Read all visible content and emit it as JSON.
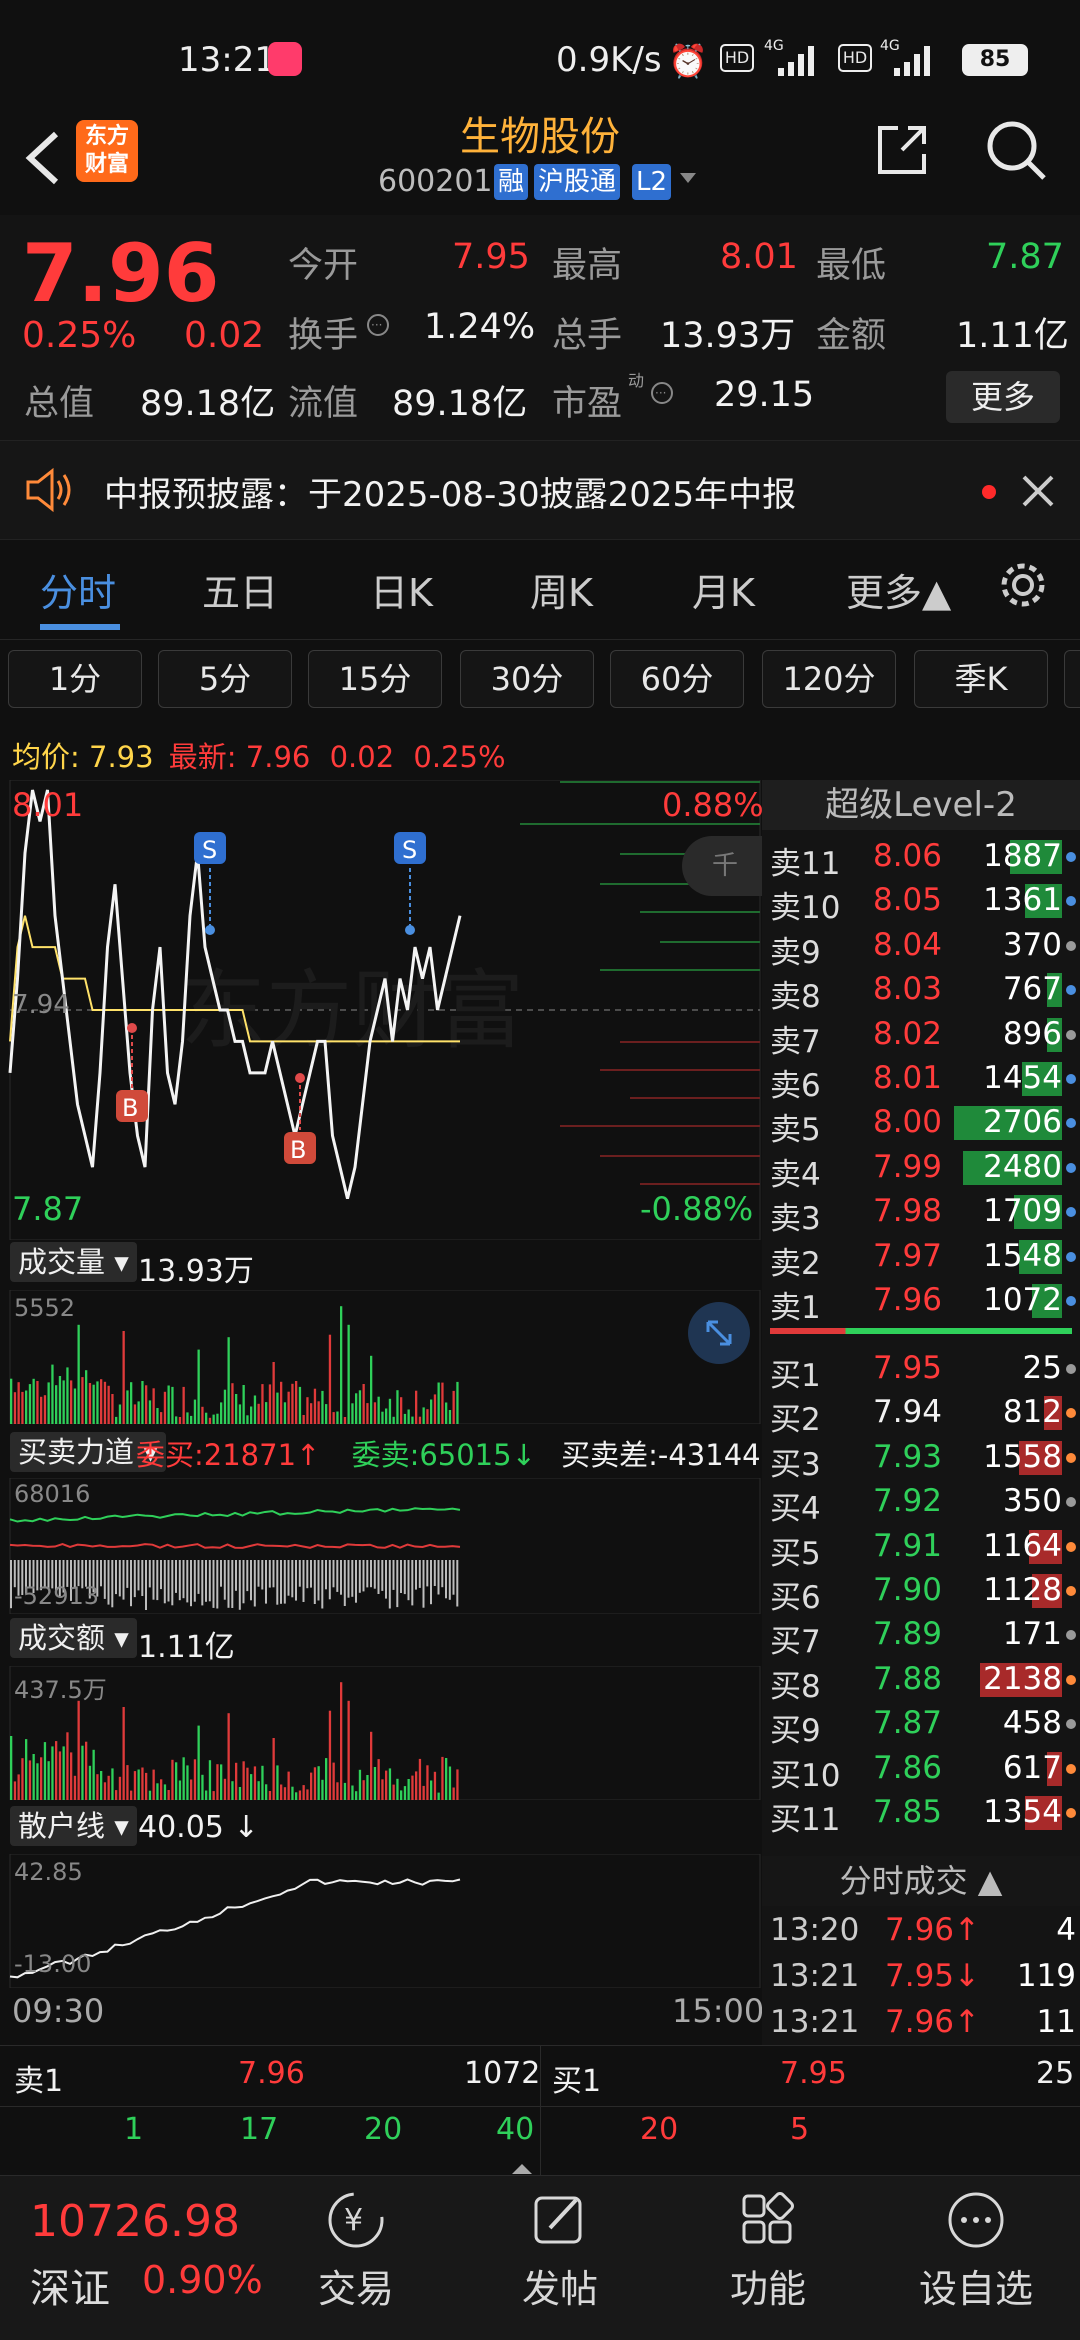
{
  "status": {
    "time": "13:21",
    "network_speed": "0.9K/s",
    "battery": "85"
  },
  "header": {
    "logo_line1": "东方",
    "logo_line2": "财富",
    "title": "生物股份",
    "code": "600201",
    "badges": [
      "融",
      "沪股通",
      "L2"
    ]
  },
  "quote": {
    "price": "7.96",
    "change_pct": "0.25%",
    "change": "0.02",
    "open_label": "今开",
    "open": "7.95",
    "high_label": "最高",
    "high": "8.01",
    "low_label": "最低",
    "low": "7.87",
    "turnover_label": "换手",
    "turnover": "1.24%",
    "volume_label": "总手",
    "volume": "13.93万",
    "amount_label": "金额",
    "amount": "1.11亿",
    "mcap_label": "总值",
    "mcap": "89.18亿",
    "float_label": "流值",
    "float": "89.18亿",
    "pe_label": "市盈",
    "pe_sup": "动",
    "pe": "29.15",
    "more_label": "更多"
  },
  "notice": {
    "text": "中报预披露：于2025-08-30披露2025年中报"
  },
  "tabs": [
    "分时",
    "五日",
    "日K",
    "周K",
    "月K",
    "更多▲"
  ],
  "periods": [
    "1分",
    "5分",
    "15分",
    "30分",
    "60分",
    "120分",
    "季K"
  ],
  "chart": {
    "avg_label": "均价:",
    "avg": "7.93",
    "latest_label": "最新:",
    "latest": "7.96",
    "latest_change": "0.02",
    "latest_pct": "0.25%",
    "ymax": "8.01",
    "ymin": "7.87",
    "ymid": "7.94",
    "pct_max": "0.88%",
    "pct_min": "-0.88%",
    "watermark": "东方财富",
    "marker_S": "S",
    "marker_B": "B",
    "volume_label": "成交量",
    "volume_value": "13.93万",
    "volume_max": "5552",
    "force_label": "买卖力道",
    "bid_label": "委买:21871",
    "bid_arrow": "↑",
    "ask_label": "委卖:65015",
    "ask_arrow": "↓",
    "diff_label": "买卖差:-43144",
    "diff_arrow": "↑",
    "force_max": "68016",
    "force_min": "-52913",
    "amount_label": "成交额",
    "amount_value": "1.11亿",
    "amount_max": "437.5万",
    "retail_label": "散户线",
    "retail_value": "40.05",
    "retail_arrow": "↓",
    "retail_max": "42.85",
    "retail_min": "-13.00",
    "time_start": "09:30",
    "time_end": "15:00",
    "price_line": [
      7.92,
      7.95,
      7.99,
      8.01,
      8.0,
      8.01,
      7.97,
      7.95,
      7.93,
      7.91,
      7.9,
      7.89,
      7.92,
      7.96,
      7.98,
      7.95,
      7.92,
      7.9,
      7.89,
      7.94,
      7.96,
      7.92,
      7.91,
      7.93,
      7.97,
      7.99,
      7.96,
      7.95,
      7.94,
      7.94,
      7.93,
      7.93,
      7.92,
      7.92,
      7.92,
      7.93,
      7.92,
      7.91,
      7.9,
      7.91,
      7.92,
      7.93,
      7.93,
      7.9,
      7.89,
      7.88,
      7.89,
      7.91,
      7.93,
      7.94,
      7.95,
      7.93,
      7.95,
      7.94,
      7.96,
      7.95,
      7.96,
      7.94,
      7.95,
      7.96,
      7.97
    ],
    "avg_line": [
      7.93,
      7.96,
      7.97,
      7.96,
      7.96,
      7.96,
      7.96,
      7.95,
      7.95,
      7.95,
      7.95,
      7.94,
      7.94,
      7.94,
      7.94,
      7.94,
      7.94,
      7.94,
      7.94,
      7.94,
      7.94,
      7.94,
      7.94,
      7.94,
      7.94,
      7.94,
      7.94,
      7.94,
      7.94,
      7.94,
      7.94,
      7.94,
      7.93,
      7.93,
      7.93,
      7.93,
      7.93,
      7.93,
      7.93,
      7.93,
      7.93,
      7.93,
      7.93,
      7.93,
      7.93,
      7.93,
      7.93,
      7.93,
      7.93,
      7.93,
      7.93,
      7.93,
      7.93,
      7.93,
      7.93,
      7.93,
      7.93,
      7.93,
      7.93,
      7.93,
      7.93
    ]
  },
  "orderbook": {
    "title": "超级Level-2",
    "sells": [
      {
        "label": "卖11",
        "price": "8.06",
        "vol": "1887",
        "pc": "red",
        "bar": 0.35,
        "dot": "#4a8fe0"
      },
      {
        "label": "卖10",
        "price": "8.05",
        "vol": "1361",
        "pc": "red",
        "bar": 0.25,
        "dot": "#4a8fe0"
      },
      {
        "label": "卖9",
        "price": "8.04",
        "vol": "370",
        "pc": "red",
        "bar": 0,
        "dot": "#9a9a9a"
      },
      {
        "label": "卖8",
        "price": "8.03",
        "vol": "767",
        "pc": "red",
        "bar": 0.1,
        "dot": "#4a8fe0"
      },
      {
        "label": "卖7",
        "price": "8.02",
        "vol": "896",
        "pc": "red",
        "bar": 0.1,
        "dot": "#9a9a9a"
      },
      {
        "label": "卖6",
        "price": "8.01",
        "vol": "1454",
        "pc": "red",
        "bar": 0.27,
        "dot": "#4a8fe0"
      },
      {
        "label": "卖5",
        "price": "8.00",
        "vol": "2706",
        "pc": "red",
        "bar": 0.72,
        "dot": "#4a8fe0"
      },
      {
        "label": "卖4",
        "price": "7.99",
        "vol": "2480",
        "pc": "red",
        "bar": 0.66,
        "dot": "#4a8fe0"
      },
      {
        "label": "卖3",
        "price": "7.98",
        "vol": "1709",
        "pc": "red",
        "bar": 0.32,
        "dot": "#4a8fe0"
      },
      {
        "label": "卖2",
        "price": "7.97",
        "vol": "1548",
        "pc": "red",
        "bar": 0.29,
        "dot": "#4a8fe0"
      },
      {
        "label": "卖1",
        "price": "7.96",
        "vol": "1072",
        "pc": "red",
        "bar": 0.2,
        "dot": "#4a8fe0"
      }
    ],
    "buys": [
      {
        "label": "买1",
        "price": "7.95",
        "vol": "25",
        "pc": "red",
        "bar": 0,
        "dot": "#9a9a9a"
      },
      {
        "label": "买2",
        "price": "7.94",
        "vol": "812",
        "pc": "white",
        "bar": 0.12,
        "dot": "#ff8a3a"
      },
      {
        "label": "买3",
        "price": "7.93",
        "vol": "1558",
        "pc": "green",
        "bar": 0.29,
        "dot": "#ff8a3a"
      },
      {
        "label": "买4",
        "price": "7.92",
        "vol": "350",
        "pc": "green",
        "bar": 0,
        "dot": "#9a9a9a"
      },
      {
        "label": "买5",
        "price": "7.91",
        "vol": "1164",
        "pc": "green",
        "bar": 0.22,
        "dot": "#ff8a3a"
      },
      {
        "label": "买6",
        "price": "7.90",
        "vol": "1128",
        "pc": "green",
        "bar": 0.2,
        "dot": "#ff8a3a"
      },
      {
        "label": "买7",
        "price": "7.89",
        "vol": "171",
        "pc": "green",
        "bar": 0,
        "dot": "#9a9a9a"
      },
      {
        "label": "买8",
        "price": "7.88",
        "vol": "2138",
        "pc": "green",
        "bar": 0.55,
        "dot": "#ff8a3a"
      },
      {
        "label": "买9",
        "price": "7.87",
        "vol": "458",
        "pc": "green",
        "bar": 0,
        "dot": "#9a9a9a"
      },
      {
        "label": "买10",
        "price": "7.86",
        "vol": "617",
        "pc": "green",
        "bar": 0.1,
        "dot": "#ff8a3a"
      },
      {
        "label": "买11",
        "price": "7.85",
        "vol": "1354",
        "pc": "green",
        "bar": 0.25,
        "dot": "#ff8a3a"
      }
    ],
    "trades_title": "分时成交",
    "trades": [
      {
        "time": "13:20",
        "price": "7.96↑",
        "vol": "4",
        "pc": "red",
        "vc": "red"
      },
      {
        "time": "13:21",
        "price": "7.95↓",
        "vol": "119",
        "pc": "red",
        "vc": "green"
      },
      {
        "time": "13:21",
        "price": "7.96↑",
        "vol": "11",
        "pc": "red",
        "vc": "red"
      }
    ]
  },
  "bottomq": {
    "ask_label": "卖1",
    "ask_price": "7.96",
    "ask_vol": "1072",
    "bid_label": "买1",
    "bid_price": "7.95",
    "bid_vol": "25",
    "ask_detail": [
      "1",
      "17",
      "20",
      "40"
    ],
    "bid_detail": [
      "20",
      "5"
    ]
  },
  "nav": {
    "index_value": "10726.98",
    "index_name": "深证",
    "index_pct": "0.90%",
    "items": [
      "交易",
      "发帖",
      "功能",
      "设自选"
    ]
  }
}
